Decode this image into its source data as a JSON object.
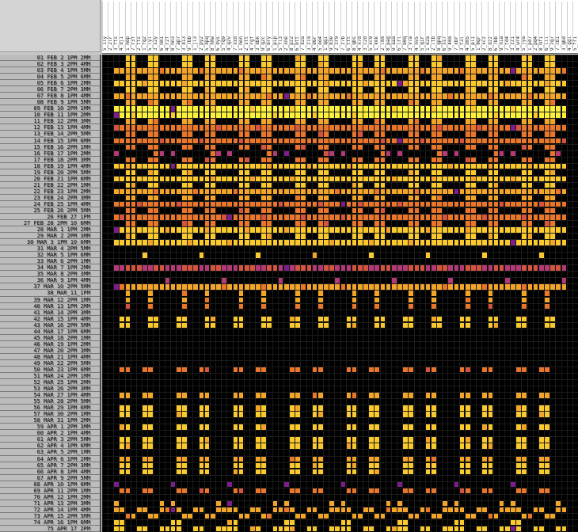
{
  "window": {
    "corner_label": ""
  },
  "column_header": {
    "labels": [
      "5_1ly",
      "2_2lr",
      "3_fts",
      "4_dj1",
      "1_mdp",
      "7_r3f",
      "2_tts",
      "1_fq2",
      "5_lyl",
      "3_s2y",
      "6_mm1",
      "4_r2f",
      "8_mn3",
      "7_ap7",
      "3_d13",
      "9_7bb",
      "1_jl3",
      "2_py2",
      "5_dpq",
      "8_hmw",
      "6_dys",
      "5_fq9",
      "4_q2v",
      "7_xxd",
      "1_mon",
      "2_stt",
      "4_rgf",
      "3_dbk",
      "9_q2c",
      "6_bry",
      "1_pip",
      "5_fl3",
      "2_xne",
      "8_pz2",
      "6_btt",
      "7_d2a",
      "3_zlm",
      "4_d6r",
      "5_oo4",
      "1_qg1",
      "9_b3e",
      "2_zr9",
      "7_z7b",
      "6_ttt",
      "8_qbs",
      "4_n7d",
      "3_c2d",
      "5_xc9",
      "1_kkk",
      "2_lmm",
      "8_pag",
      "9_aaa",
      "6_lrl",
      "7_b0q",
      "3_v7a",
      "4_nv5",
      "5_q1r",
      "1_e2a",
      "2_ltb",
      "8_gpq",
      "6_ss7",
      "9_4mm",
      "7_xbr",
      "3_t3l",
      "4_dm5",
      "5_pl1",
      "1_0qr",
      "2_xcz",
      "8_dzz",
      "6_7bb",
      "9_n1a",
      "7_td4",
      "3_zz1",
      "4_wr4",
      "5_jya",
      "1_pd7",
      "2_pq4",
      "8_mf1",
      "6_lll",
      "9_zq7",
      "7_cb1",
      "3_qbd",
      "4_ggl",
      "5_fr1"
    ]
  },
  "row_header": {
    "labels": [
      "01_FEB_2_1PM_2MM",
      "02_FEB_3_2PM_4MM",
      "03_FEB_4_1PM_5MM",
      "04_FEB_5_2PM_6MM",
      "05_FEB_6_1PM_2MM",
      "06_FEB_7_2PM_3MM",
      "07_FEB_8_1PM_4MM",
      "08_FEB_9_1PM_5MM",
      "09_FEB_10_2PM_1MM",
      "10_FEB_11_1PM_2MM",
      "11_FEB_12_2PM_3MM",
      "12_FEB_13_1PM_4MM",
      "13_FEB_14_2PM_5MM",
      "14_FEB_15_1PM_6MM",
      "15_FEB_16_2PM_1MM",
      "16_FEB_17_1PM_2MM",
      "17_FEB_18_2PM_3MM",
      "18_FEB_19_1PM_4MM",
      "19_FEB_20_2PM_5MM",
      "20_FEB_21_1PM_6MM",
      "21_FEB_22_2PM_1MM",
      "22_FEB_23_1PM_2MM",
      "23_FEB_24_2PM_3MM",
      "24_FEB_25_1PM_4MM",
      "25_FEB_26_2PM_5MM",
      "26_FEB_27_1PM",
      "27_FEB_28_2PM_10_6MM",
      "28_MAR_1_1PM_2MM",
      "29_MAR_2_2PM_3MM",
      "30_MAR_3_1PM_10_6MM",
      "31_MAR_4_2PM_5MM",
      "32_MAR_5_1PM_6MM",
      "33_MAR_6_2PM_1MM",
      "34_MAR_7_1PM_2MM",
      "35_MAR_8_2PM_3MM",
      "36_MAR_9_1PM_4MM",
      "37_MAR_10_2PM_5MM",
      "38_MAR_11_1PM",
      "39_MAR_12_2PM_1MM",
      "40_MAR_13_1PM_2MM",
      "41_MAR_14_2PM_3MM",
      "42_MAR_15_1PM_4MM",
      "43_MAR_16_2PM_5MM",
      "44_MAR_17_1PM_6MM",
      "45_MAR_18_2PM_1MM",
      "46_MAR_19_1PM_2MM",
      "47_MAR_20_2PM_3MM",
      "48_MAR_21_1PM_4MM",
      "49_MAR_22_2PM_5MM",
      "50_MAR_23_1PM_6MM",
      "51_MAR_24_2PM_1MM",
      "52_MAR_25_1PM_2MM",
      "53_MAR_26_2PM_3MM",
      "54_MAR_27_1PM_4MM",
      "55_MAR_28_2PM_5MM",
      "56_MAR_29_1PM_6MM",
      "57_MAR_30_2PM_1MM",
      "58_MAR_31_1PM_2MM",
      "59_APR_1_2PM_3MM",
      "60_APR_2_1PM_4MM",
      "61_APR_3_2PM_5MM",
      "62_APR_4_1PM_6MM",
      "63_APR_5_2PM_1MM",
      "64_APR_6_1PM_2MM",
      "65_APR_7_2PM_3MM",
      "66_APR_8_1PM_4MM",
      "67_APR_9_2PM_5MM",
      "68_APR_10_1PM_6MM",
      "69_APR_11_2PM_1MM",
      "70_APR_12_1PM_2MM",
      "71_APR_13_2PM_3MM",
      "72_APR_14_1PM_4MM",
      "73_APR_15_2PM_5MM",
      "74_APR_16_1PM_6MM",
      "75_APR_17_2PM"
    ]
  },
  "colors": {
    "background": "#000000",
    "palette": [
      "#000000",
      "#4b0c6b",
      "#7b1d8c",
      "#b33a77",
      "#d5543f",
      "#e9762a",
      "#f3a52a",
      "#fac92d",
      "#fcf03a"
    ]
  },
  "chart_data": {
    "type": "heatmap",
    "n_cols": 84,
    "n_rows": 75,
    "blocks_per_row": 8,
    "block_width": 10,
    "block_gap": 0,
    "shape_rows": [
      "..77..77..",
      "..77..77..",
      "6666666666",
      "..66..66..",
      "7777777777",
      "..77..77..",
      "6666666666",
      "..66..66..",
      "8888888888",
      "8888888888",
      "..66..66..",
      "5555555555",
      "..55..55..",
      "5555555555",
      "..55..55..",
      "3......53.",
      "..55..55..",
      "7777777777",
      "..77..77..",
      "7777777777",
      "..77..77..",
      "6666666666",
      "..66..66..",
      "5555555555",
      "..55..55..",
      "5555555555",
      "..55..55..",
      "7777777777",
      "..77..77..",
      "7777777777",
      "..........",
      ".....7....",
      "..........",
      "3344433443",
      "..........",
      ".........3",
      "6666666666",
      "..6...6...",
      "..6...6...",
      "..5...5...",
      "..........",
      ".77...77..",
      ".77...77..",
      "..........",
      "..........",
      "..........",
      "..........",
      "..........",
      "..........",
      ".55..55...",
      "..........",
      "..........",
      "..........",
      ".66..66...",
      "..........",
      ".77..77...",
      ".77..77...",
      "..........",
      ".77..77...",
      "..........",
      ".77..77...",
      ".77..77...",
      "..........",
      ".66..66...",
      ".77..77...",
      ".77..77...",
      "..........",
      "2.........",
      ".55..55...",
      "..........",
      "6.......6.",
      "66..66..66",
      "..66..66..",
      "77........",
      "77..77..77"
    ]
  }
}
